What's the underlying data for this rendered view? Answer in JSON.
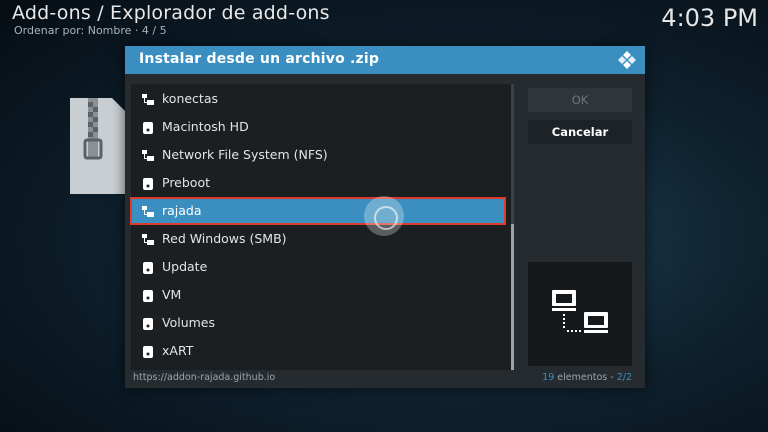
{
  "header": {
    "title": "Add-ons / Explorador de add-ons",
    "subtitle": "Ordenar por: Nombre  ·  4 / 5",
    "clock": "4:03 PM"
  },
  "dialog": {
    "title": "Instalar desde un archivo .zip",
    "items": [
      {
        "label": "konectas",
        "icon": "network-share-icon"
      },
      {
        "label": "Macintosh HD",
        "icon": "drive-icon"
      },
      {
        "label": "Network File System (NFS)",
        "icon": "network-share-icon"
      },
      {
        "label": "Preboot",
        "icon": "drive-icon"
      },
      {
        "label": "rajada",
        "icon": "network-share-icon",
        "selected": true
      },
      {
        "label": "Red Windows (SMB)",
        "icon": "network-share-icon"
      },
      {
        "label": "Update",
        "icon": "drive-icon"
      },
      {
        "label": "VM",
        "icon": "drive-icon"
      },
      {
        "label": "Volumes",
        "icon": "drive-icon"
      },
      {
        "label": "xART",
        "icon": "drive-icon"
      }
    ],
    "ok_label": "OK",
    "cancel_label": "Cancelar",
    "footer_path": "https://addon-rajada.github.io",
    "footer_count": "19",
    "footer_count_suffix": " elementos - ",
    "footer_page": "2/2"
  },
  "colors": {
    "accent": "#3a8fc0",
    "selection_outline": "#e03b2a",
    "dialog_bg": "#262b2f"
  }
}
